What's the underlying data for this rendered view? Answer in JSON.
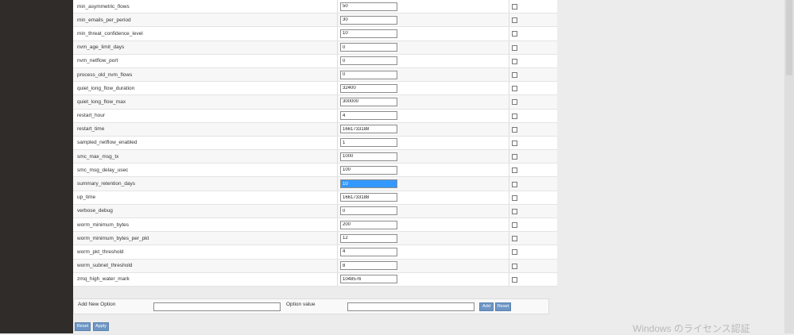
{
  "options": [
    {
      "name": "min_asymmetric_flows",
      "value": "50"
    },
    {
      "name": "min_emails_per_period",
      "value": "30"
    },
    {
      "name": "min_threat_confidence_level",
      "value": "10"
    },
    {
      "name": "nvm_age_limit_days",
      "value": "0"
    },
    {
      "name": "nvm_netflow_port",
      "value": "0"
    },
    {
      "name": "process_old_nvm_flows",
      "value": "0"
    },
    {
      "name": "quiet_long_flow_duration",
      "value": "32400"
    },
    {
      "name": "quiet_long_flow_max",
      "value": "300000"
    },
    {
      "name": "restart_hour",
      "value": "4"
    },
    {
      "name": "restart_time",
      "value": "1661733188"
    },
    {
      "name": "sampled_netflow_enabled",
      "value": "1"
    },
    {
      "name": "smc_max_msg_tx",
      "value": "1000"
    },
    {
      "name": "smc_msg_delay_usec",
      "value": "100"
    },
    {
      "name": "summary_retention_days",
      "value": "10"
    },
    {
      "name": "up_time",
      "value": "1661733188"
    },
    {
      "name": "verbose_debug",
      "value": "0"
    },
    {
      "name": "worm_minimum_bytes",
      "value": "200"
    },
    {
      "name": "worm_minimum_bytes_per_pkt",
      "value": "12"
    },
    {
      "name": "worm_pkt_threshold",
      "value": "4"
    },
    {
      "name": "worm_subnet_threshold",
      "value": "8"
    },
    {
      "name": "zmq_high_water_mark",
      "value": "1048576"
    }
  ],
  "add_option": {
    "label": "Add New Option",
    "value_label": "Option value",
    "name_value": "",
    "value_value": "",
    "add_label": "Add",
    "reset_label": "Reset"
  },
  "footer": {
    "reset_label": "Reset",
    "apply_label": "Apply"
  },
  "watermark": "Windows のライセンス認証"
}
